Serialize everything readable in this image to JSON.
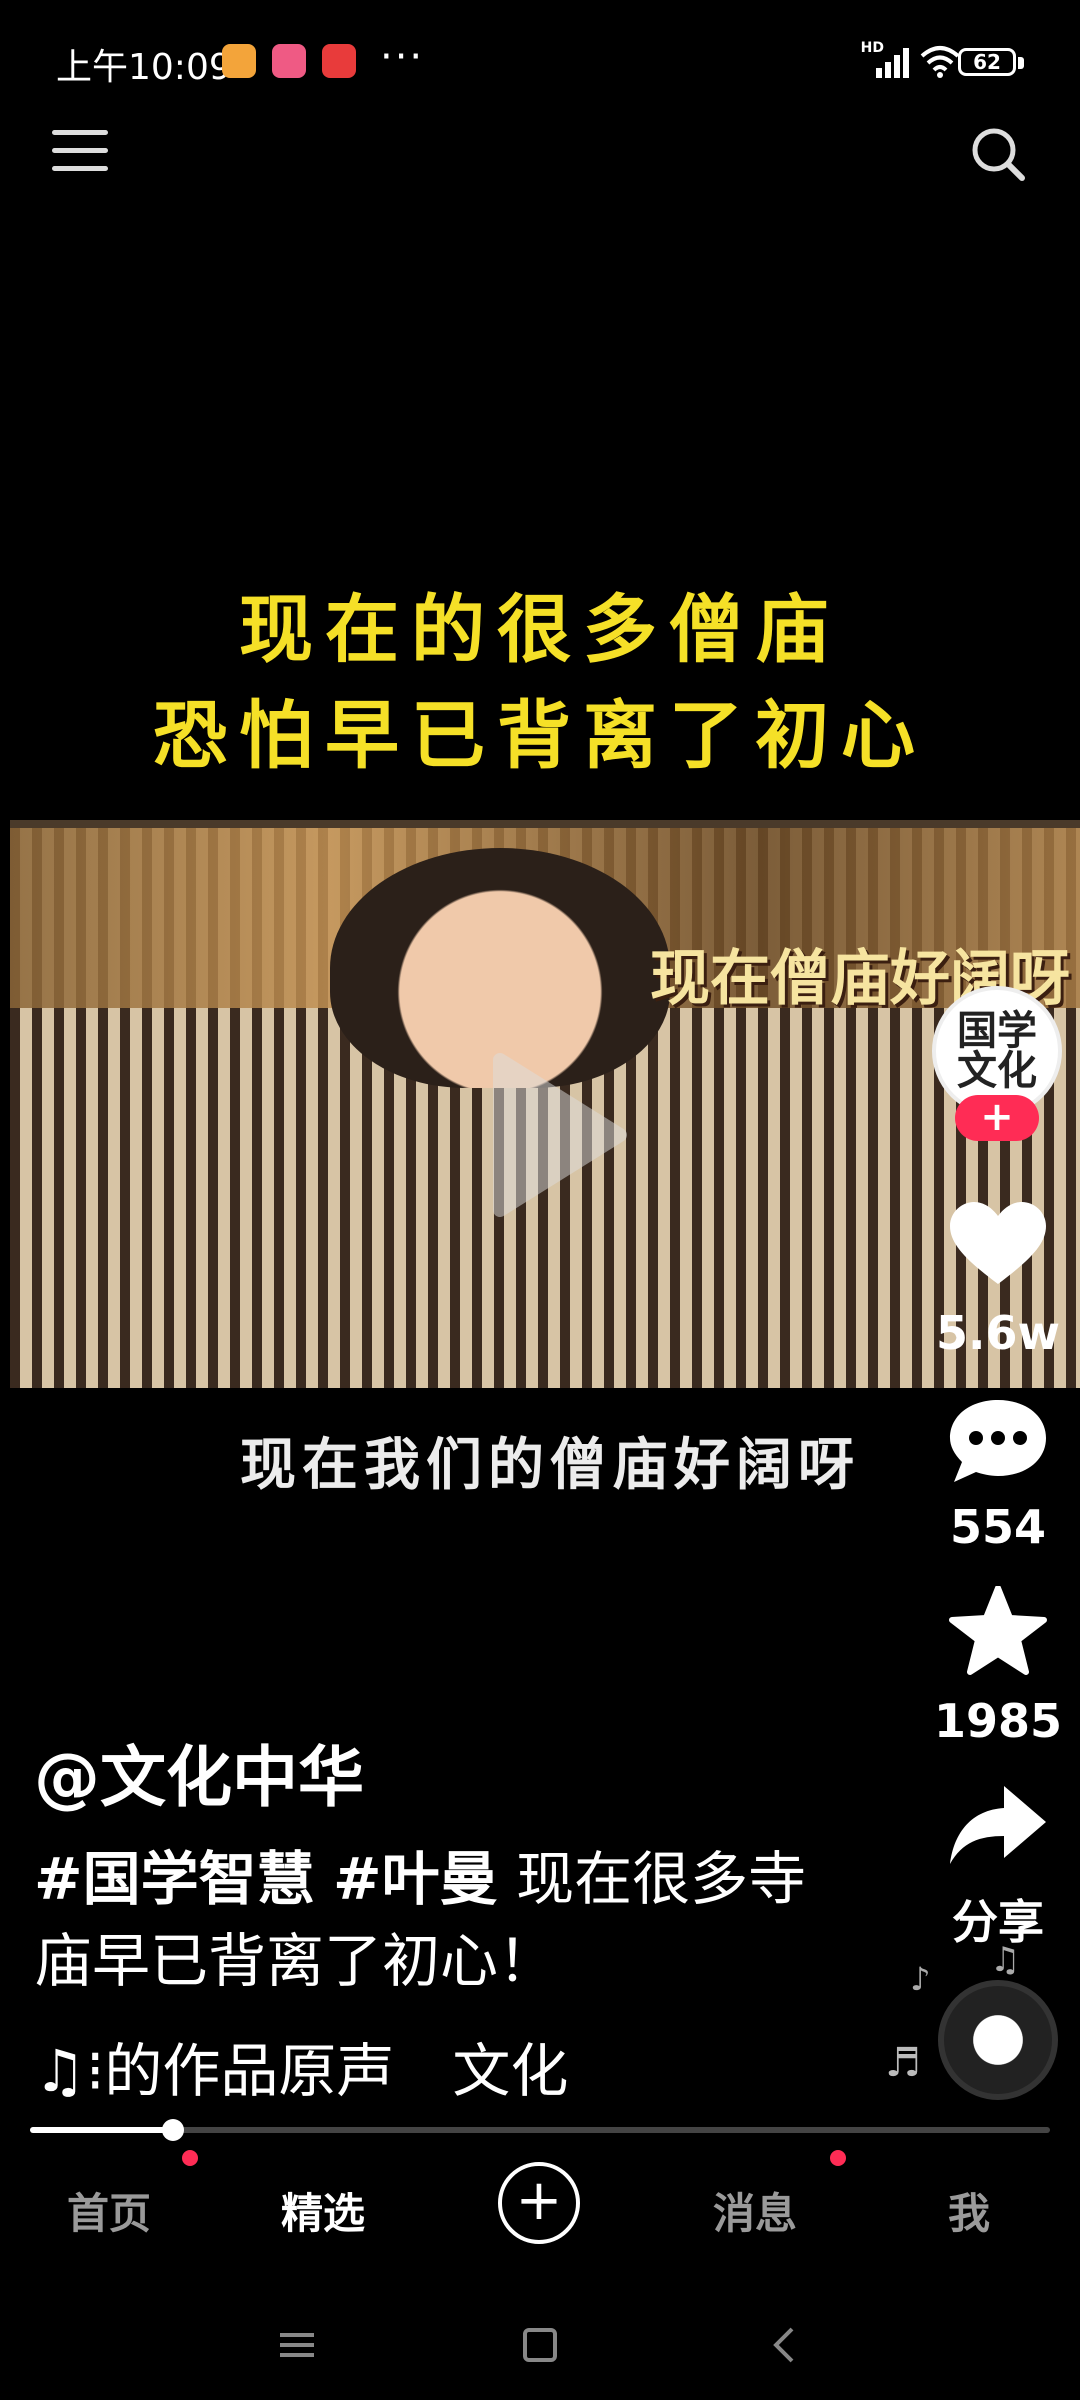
{
  "status_bar": {
    "time": "上午10:09",
    "more": "···",
    "battery": "62",
    "signal_label": "HD"
  },
  "video": {
    "caption_line1": "现在的很多僧庙",
    "caption_line2": "恐怕早已背离了初心",
    "overlay_text": "现在僧庙好阔呀",
    "subtitle": "现在我们的僧庙好阔呀",
    "avatar_text": "国学文化"
  },
  "rail": {
    "follow": "+",
    "likes": "5.6w",
    "comments": "554",
    "favorites": "1985",
    "share": "分享"
  },
  "post": {
    "author": "@文化中华",
    "tag1": "#国学智慧",
    "tag2": "#叶曼",
    "text": "现在很多寺庙早已背离了初心！",
    "music": "♫⁝的作品原声　文化"
  },
  "progress": {
    "fraction": 0.14
  },
  "tabs": {
    "home": "首页",
    "featured": "精选",
    "add": "+",
    "messages": "消息",
    "me": "我"
  },
  "colors": {
    "accent": "#ff2c55",
    "caption": "#f5e027"
  },
  "icons": [
    "menu-icon",
    "search-icon",
    "play-icon",
    "heart-icon",
    "comment-icon",
    "star-icon",
    "share-icon"
  ]
}
